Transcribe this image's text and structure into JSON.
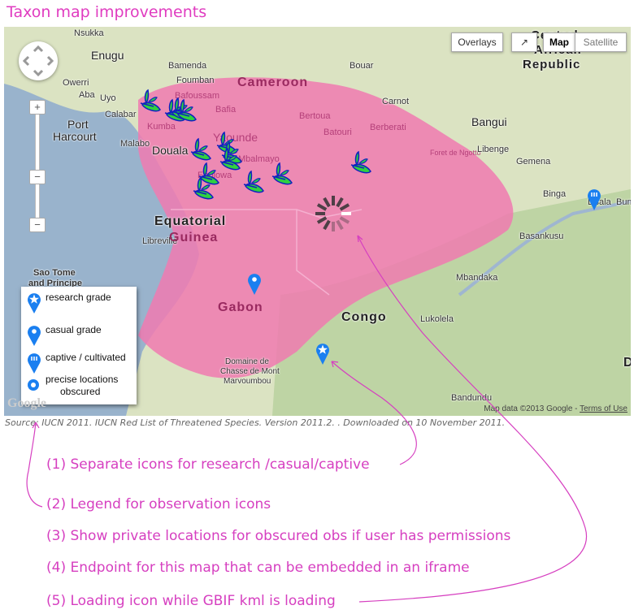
{
  "title": "Taxon map improvements",
  "map": {
    "controls": {
      "overlays": "Overlays",
      "fullscreen_icon": "external-link-icon",
      "map": "Map",
      "satellite": "Satellite",
      "zoom_in": "+",
      "zoom_out": "−"
    },
    "labels": {
      "nsukka": "Nsukka",
      "enugu": "Enugu",
      "owerri": "Owerri",
      "aba": "Aba",
      "uyo": "Uyo",
      "port": "Port",
      "harcourt": "Harcourt",
      "calabar": "Calabar",
      "malabo": "Malabo",
      "douala": "Douala",
      "bamenda": "Bamenda",
      "foumban": "Foumban",
      "bafoussam": "Bafoussam",
      "kumba": "Kumba",
      "bafia": "Bafia",
      "yaounde": "Yaounde",
      "mbalmayo": "Mbalmayo",
      "ebolowa": "Ebolowa",
      "cameroon": "Cameroon",
      "bertoua": "Bertoua",
      "batouri": "Batouri",
      "bouar": "Bouar",
      "carnot": "Carnot",
      "berberati": "Berberati",
      "bangui": "Bangui",
      "libenge": "Libenge",
      "gemena": "Gemena",
      "binga": "Binga",
      "lisala": "Lisala",
      "bumba": "Bum",
      "basankusu": "Basankusu",
      "mbandaka": "Mbandaka",
      "lukolela": "Lukolela",
      "congo": "Congo",
      "gabon": "Gabon",
      "libreville": "Libreville",
      "eq1": "Equatorial",
      "eq2": "Guinea",
      "saotome": "Sao Tome",
      "principe": "and Principe",
      "domaine1": "Domaine de",
      "domaine2": "Chasse de Mont",
      "domaine3": "Marvoumbou",
      "bandundu": "Bandundu",
      "car1": "Central",
      "car2": "African",
      "car3": "Republic",
      "foret": "Foret de Ngotto",
      "d": "D"
    },
    "legend": [
      {
        "label": "research grade",
        "icon": "star-pin-icon"
      },
      {
        "label": "casual grade",
        "icon": "pin-icon"
      },
      {
        "label": "captive / cultivated",
        "icon": "striped-pin-icon"
      },
      {
        "label": "precise locations",
        "label2": "obscured",
        "icon": "circle-icon"
      }
    ],
    "attribution": "Map data ©2013 Google - ",
    "terms": "Terms of Use",
    "google_logo": "Google",
    "colors": {
      "range": "#f07ab0",
      "pin": "#1a7ff0",
      "leaf": "#30d040",
      "leaf_outline": "#1020c0",
      "sea": "#99b3cc",
      "land": "#dbe3c2"
    }
  },
  "source": "Source: IUCN 2011. IUCN Red List of Threatened Species. Version 2011.2. . Downloaded on 10 November 2011.",
  "notes": [
    "(1) Separate icons for research /casual/captive",
    "(2) Legend for observation icons",
    "(3) Show private locations for obscured obs if user has permissions",
    "(4) Endpoint for this map that can be embedded in an iframe",
    "(5) Loading icon while GBIF kml is loading"
  ],
  "accent_color": "#d63fc0"
}
